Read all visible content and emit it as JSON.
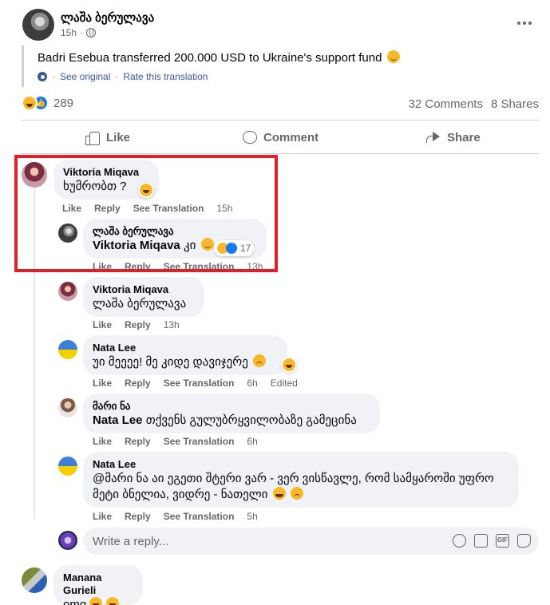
{
  "post": {
    "author": "ლაშა ბერულავა",
    "time": "15h",
    "text": "Badri Esebua transferred 200.000 USD to Ukraine's support fund",
    "see_original": "See original",
    "rate_translation": "Rate this translation",
    "reaction_count": "289",
    "comments_count": "32 Comments",
    "shares_count": "8 Shares"
  },
  "actions": {
    "like": "Like",
    "comment": "Comment",
    "share": "Share"
  },
  "comments": [
    {
      "author": "Viktoria Miqava",
      "text": "ხუმრობთ ?",
      "like": "Like",
      "reply": "Reply",
      "see_translation": "See Translation",
      "time": "15h"
    },
    {
      "author": "ლაშა ბერულავა",
      "mention": "Viktoria Miqava",
      "text": "კი",
      "reaction_count": "17",
      "like": "Like",
      "reply": "Reply",
      "see_translation": "See Translation",
      "time": "13h"
    },
    {
      "author": "Viktoria Miqava",
      "text": "ლაშა ბერულავა",
      "like": "Like",
      "reply": "Reply",
      "time": "13h"
    },
    {
      "author": "Nata Lee",
      "text": "უი მეეეე! მე კიდე დავიჯერე",
      "like": "Like",
      "reply": "Reply",
      "see_translation": "See Translation",
      "time": "6h",
      "edited": "Edited"
    },
    {
      "author": "მარი ნა",
      "mention": "Nata Lee",
      "text": "თქვენს გულუბრყვილობაზე გამეცინა",
      "like": "Like",
      "reply": "Reply",
      "see_translation": "See Translation",
      "time": "6h"
    },
    {
      "author": "Nata Lee",
      "text_line1": "@მარი ნა აი ეგეთი შტერი ვარ - ვერ ვისწავლე, რომ სამყაროში უფრო",
      "text_line2": "მეტი ბნელია, ვიდრე - ნათელი",
      "like": "Like",
      "reply": "Reply",
      "see_translation": "See Translation",
      "time": "5h"
    },
    {
      "author": "Manana Gurieli",
      "text": "omg"
    }
  ],
  "reply_box": {
    "placeholder": "Write a reply..."
  },
  "icons": {
    "more": "more-horizontal-icon",
    "privacy": "globe-icon",
    "translate": "gear-icon",
    "like": "thumbs-up-icon",
    "comment": "comment-bubble-icon",
    "share": "share-arrow-icon"
  },
  "colors": {
    "highlight_box": "#e41e26",
    "link": "#385898",
    "secondary_text": "#65676b",
    "bubble_bg": "#f0f2f5"
  }
}
